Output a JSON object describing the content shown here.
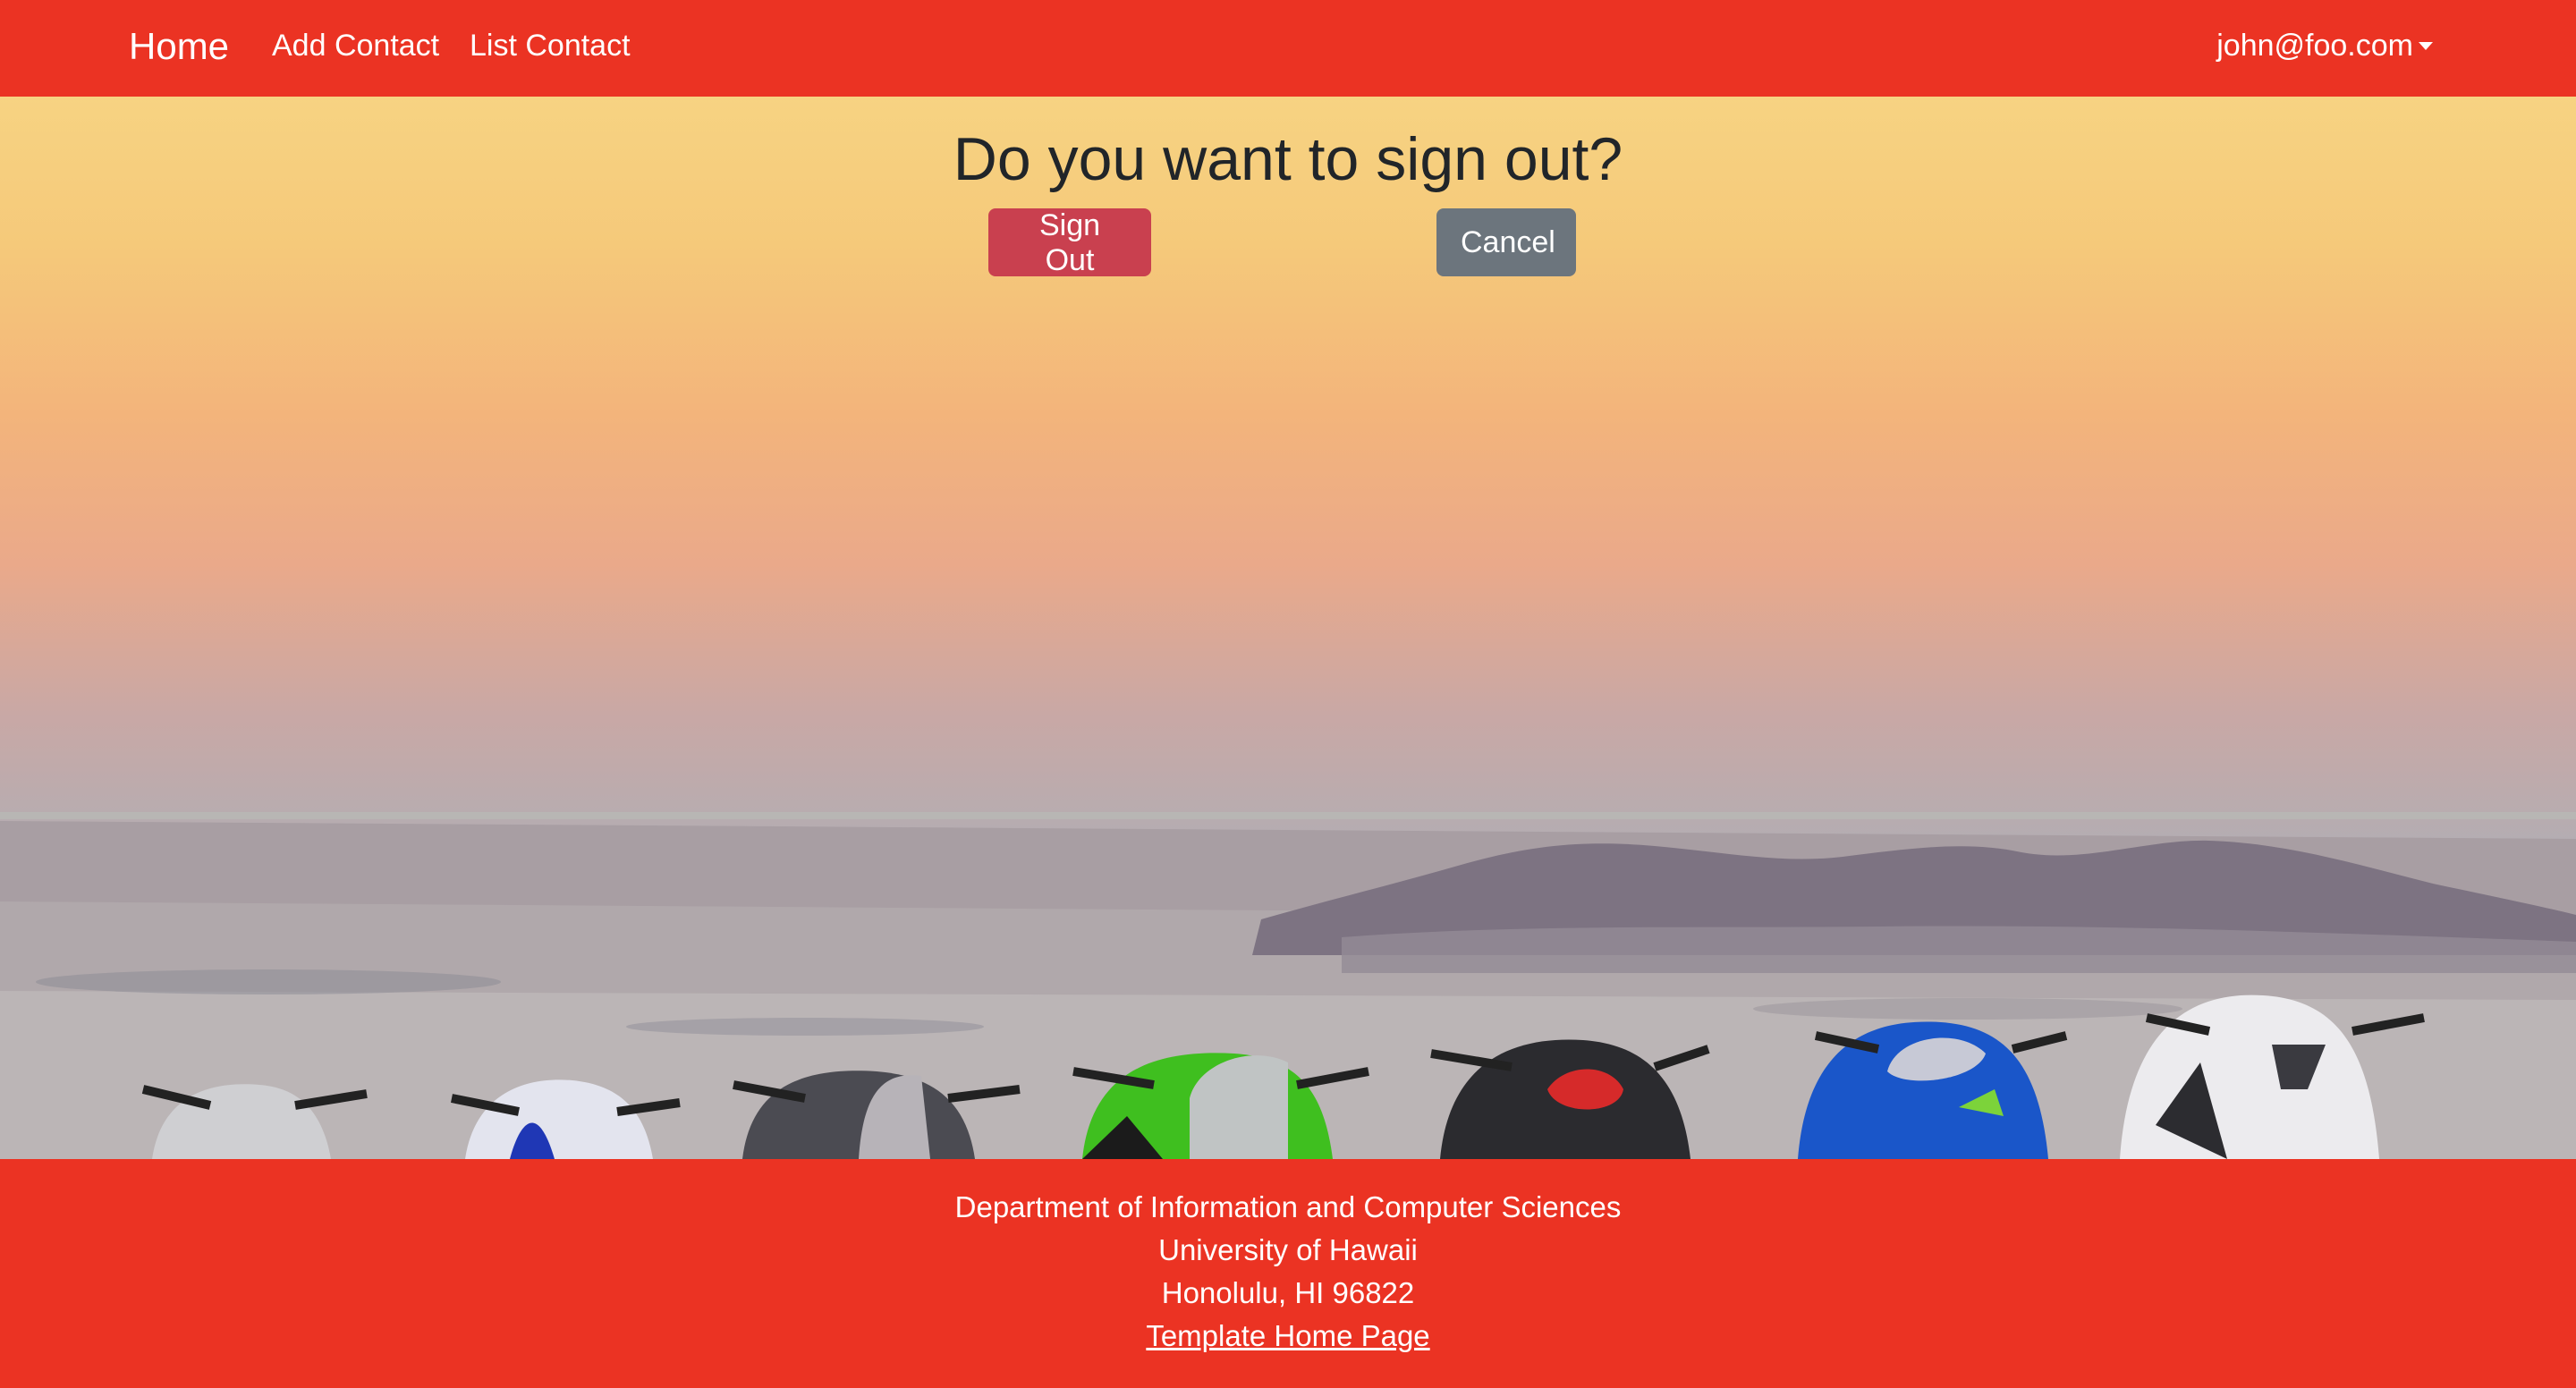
{
  "navbar": {
    "brand": "Home",
    "links": [
      {
        "label": "Add Contact"
      },
      {
        "label": "List Contact"
      }
    ],
    "user": "john@foo.com"
  },
  "signout": {
    "title": "Do you want to sign out?",
    "signout_button": "Sign Out",
    "cancel_button": "Cancel"
  },
  "footer": {
    "department": "Department of Information and Computer Sciences",
    "university": "University of Hawaii",
    "address": "Honolulu, HI 96822",
    "link": "Template Home Page"
  },
  "colors": {
    "navbar_bg": "#eb3323",
    "footer_bg": "#eb3323",
    "signout_button": "#c9404f",
    "cancel_button": "#6c757d",
    "title_text": "#212529"
  },
  "background_image": "sunset-desert-motorcycles"
}
